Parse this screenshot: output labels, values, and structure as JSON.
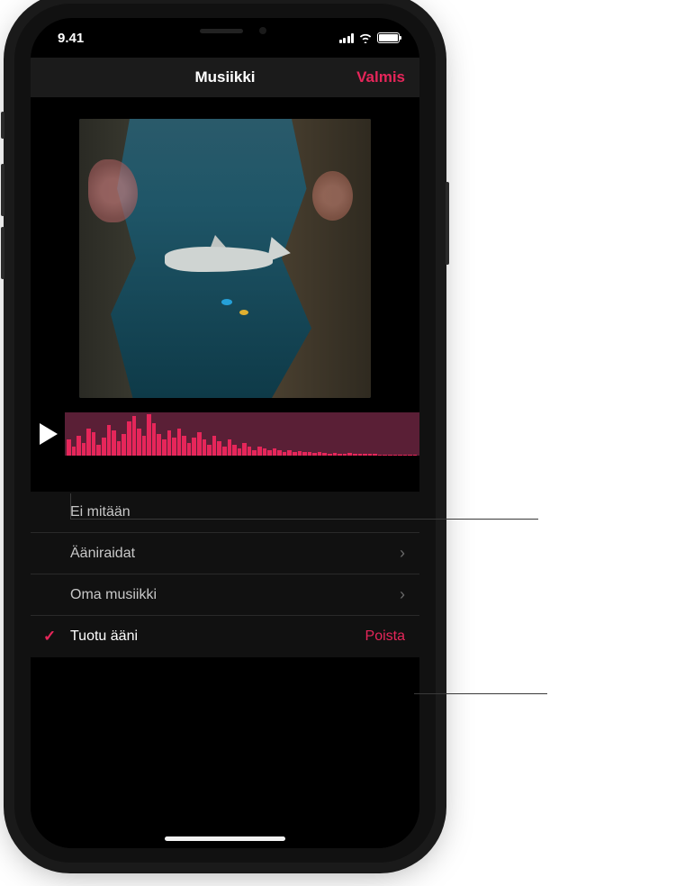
{
  "status": {
    "time": "9.41"
  },
  "nav": {
    "title": "Musiikki",
    "done": "Valmis"
  },
  "list": {
    "none": "Ei mitään",
    "soundtracks": "Ääniraidat",
    "my_music": "Oma musiikki",
    "imported": "Tuotu ääni",
    "delete": "Poista"
  },
  "waveform": {
    "heights": [
      18,
      10,
      22,
      14,
      30,
      26,
      12,
      20,
      34,
      28,
      16,
      24,
      38,
      44,
      30,
      22,
      46,
      36,
      24,
      18,
      28,
      20,
      30,
      22,
      14,
      20,
      26,
      18,
      12,
      22,
      16,
      10,
      18,
      12,
      8,
      14,
      10,
      6,
      10,
      8,
      6,
      8,
      6,
      4,
      6,
      4,
      5,
      4,
      4,
      3,
      4,
      3,
      2,
      3,
      2,
      2,
      3,
      2,
      2,
      2,
      2,
      2,
      1,
      1,
      1,
      1,
      1,
      1,
      1,
      1
    ]
  }
}
